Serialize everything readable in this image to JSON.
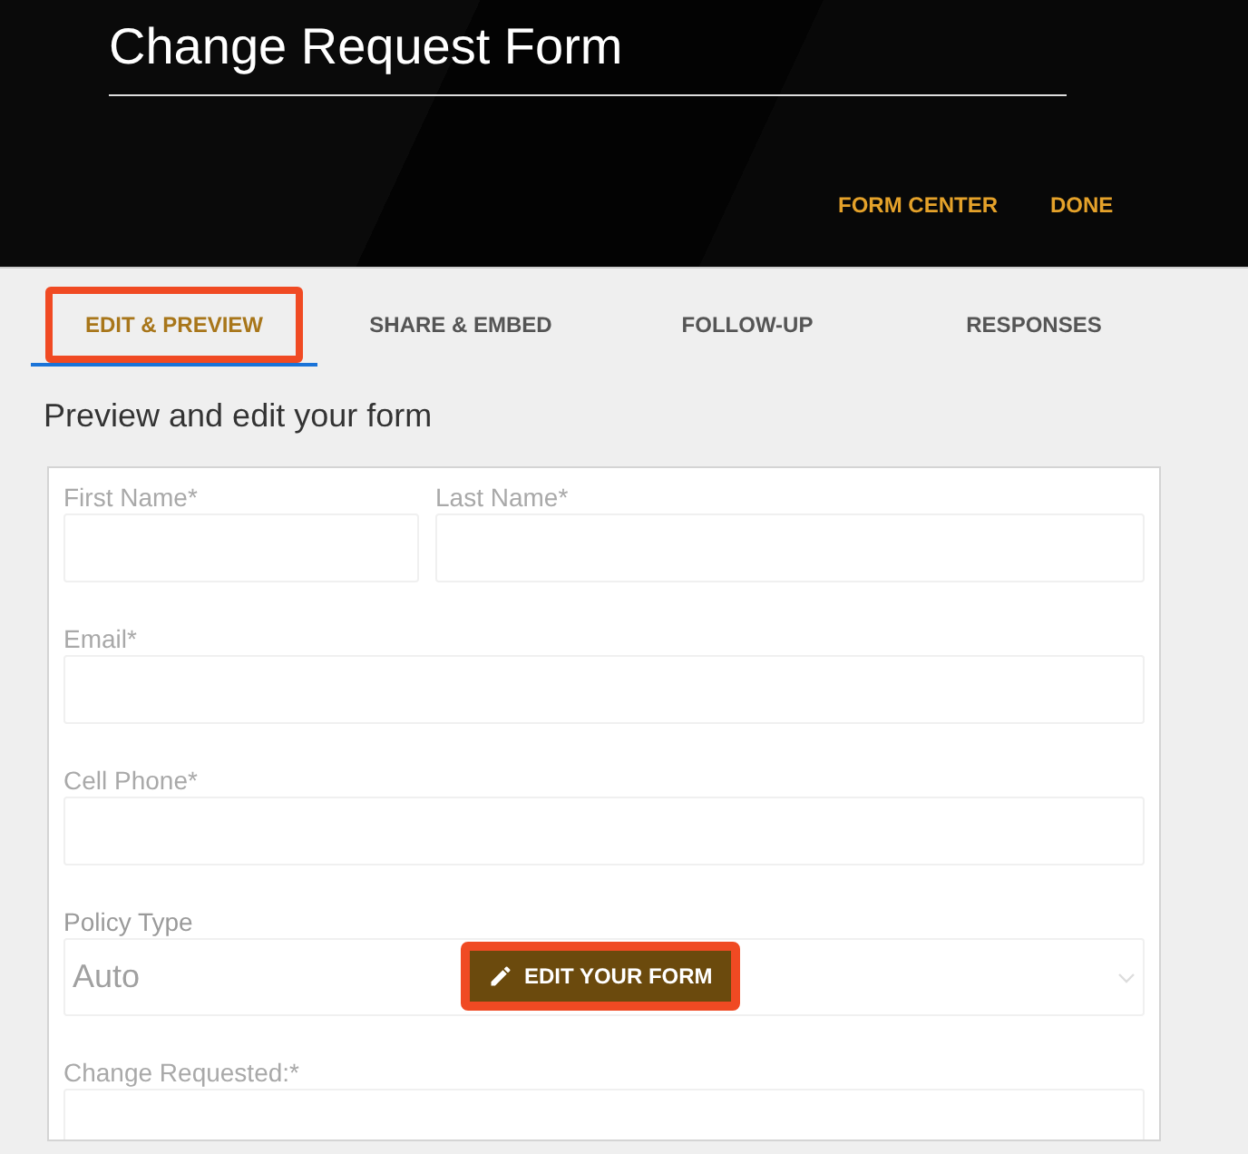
{
  "header": {
    "title": "Change Request Form",
    "links": [
      "FORM CENTER",
      "DONE"
    ]
  },
  "tabs": [
    {
      "label": "EDIT & PREVIEW",
      "selected": true,
      "highlighted": true
    },
    {
      "label": "SHARE & EMBED",
      "selected": false,
      "highlighted": false
    },
    {
      "label": "FOLLOW-UP",
      "selected": false,
      "highlighted": false
    },
    {
      "label": "RESPONSES",
      "selected": false,
      "highlighted": false
    }
  ],
  "subtitle": "Preview and edit your form",
  "form": {
    "rows": [
      [
        {
          "kind": "text",
          "label": "First Name*"
        },
        {
          "kind": "text",
          "label": "Last Name*"
        }
      ],
      [
        {
          "kind": "text",
          "label": "Email*"
        }
      ],
      [
        {
          "kind": "text",
          "label": "Cell Phone*"
        }
      ],
      [
        {
          "kind": "select",
          "label": "Policy Type",
          "value": "Auto"
        }
      ],
      [
        {
          "kind": "text",
          "label": "Change Requested:*"
        }
      ]
    ],
    "edit_button": {
      "label": "EDIT YOUR FORM",
      "highlighted": true
    }
  }
}
